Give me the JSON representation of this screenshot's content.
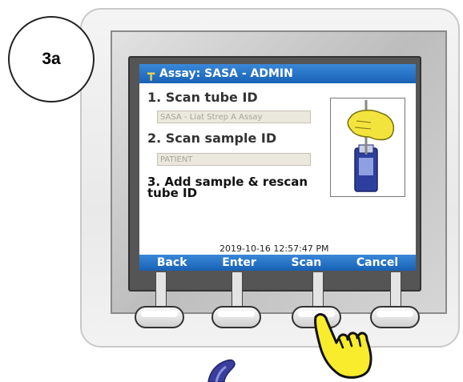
{
  "badge_label": "3a",
  "screen": {
    "title": "Assay: SASA - ADMIN",
    "step1_label": "1. Scan tube ID",
    "step1_value": "SASA - Liat Strep A Assay",
    "step2_label": "2. Scan sample ID",
    "step2_value": "PATIENT",
    "step3_line1": "3.  Add sample & rescan",
    "step3_line2": "tube ID",
    "timestamp": "2019-10-16 12:57:47 PM"
  },
  "softkeys": {
    "back": "Back",
    "enter": "Enter",
    "scan": "Scan",
    "cancel": "Cancel"
  },
  "colors": {
    "accent_blue": "#1f6cc2",
    "glove_yellow": "#f2e43c",
    "tube_blue": "#2c3f9e"
  },
  "icons": [
    "tube-icon",
    "pointing-hand-icon"
  ]
}
